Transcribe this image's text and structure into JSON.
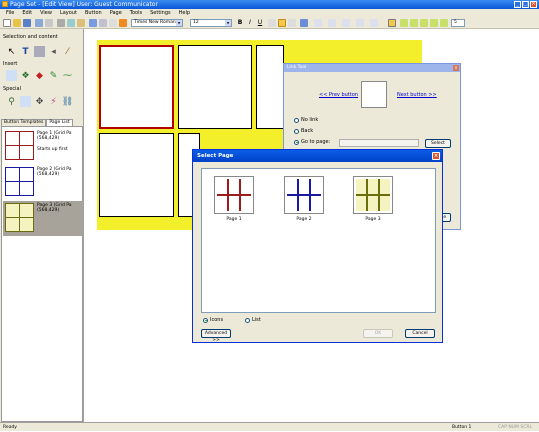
{
  "window": {
    "title": "Page Set - [Edit View]   User: Guest  Communicator"
  },
  "menu": [
    "File",
    "Edit",
    "View",
    "Layout",
    "Button",
    "Page",
    "Tools",
    "Settings",
    "Help"
  ],
  "toolbar": {
    "font": "Times New Roman",
    "size": "12",
    "bold": "B",
    "italic": "I",
    "underline": "U",
    "cols": "5"
  },
  "left_panel": {
    "section1": "Selection and content",
    "section2": "Insert",
    "section3": "Special",
    "tabs": [
      "Button Templates",
      "Page List"
    ],
    "pages": [
      {
        "label": "Page 1 (Grid Pa (568,429)",
        "note": "Starts up first",
        "color": "#9b1c1c"
      },
      {
        "label": "Page 2 (Grid Pa (568,429)",
        "note": "",
        "color": "#1a1aa0"
      },
      {
        "label": "Page 3 (Grid Pa (568,429)",
        "note": "",
        "color": "#6b6b10"
      }
    ]
  },
  "link_dialog": {
    "title": "Link Tool",
    "prev": "<< Prev button",
    "next": "Next button >>",
    "options": [
      "No link",
      "Back",
      "Go to page:"
    ],
    "select": "Select",
    "ok": "Close"
  },
  "select_page": {
    "title": "Select Page",
    "pages": [
      {
        "caption": "Page 1",
        "color": "#9b1c1c"
      },
      {
        "caption": "Page 2",
        "color": "#1a1aa0"
      },
      {
        "caption": "Page 3",
        "color": "#6b6b10"
      }
    ],
    "view_icons": "Icons",
    "view_list": "List",
    "advanced": "Advanced >>",
    "ok": "OK",
    "cancel": "Cancel"
  },
  "status": {
    "left": "Ready",
    "right": "Button 1",
    "indicators": "CAP  NUM  SCRL"
  }
}
